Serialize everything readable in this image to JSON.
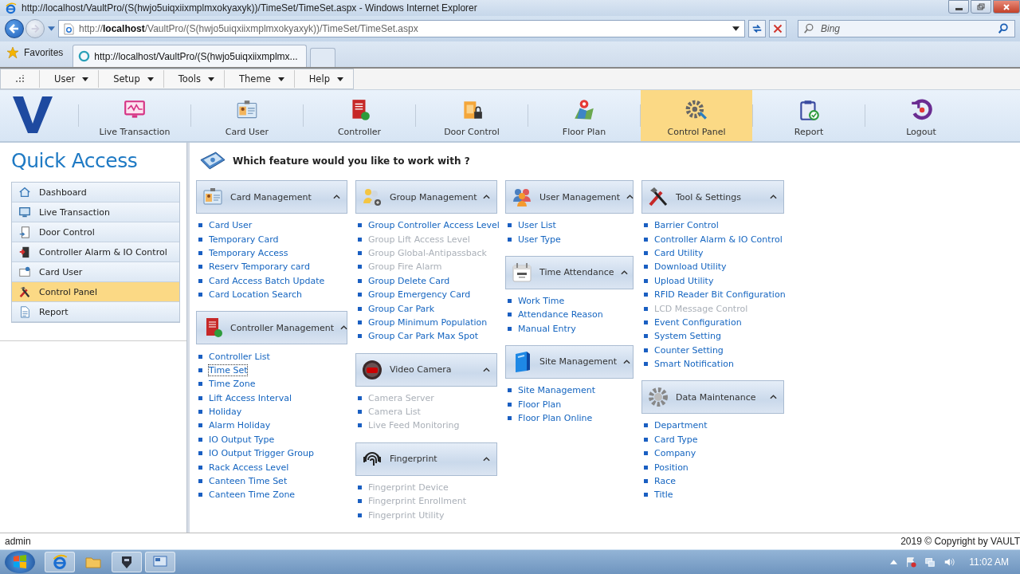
{
  "window": {
    "title": "http://localhost/VaultPro/(S(hwjo5uiqxiixmplmxokyaxyk))/TimeSet/TimeSet.aspx - Windows Internet Explorer"
  },
  "address_bar": {
    "url": "http://**localhost**/VaultPro/(S(hwjo5uiqxiixmplmxokyaxyk))/TimeSet/TimeSet.aspx"
  },
  "search": {
    "placeholder": "Bing"
  },
  "favorites": {
    "label": "Favorites"
  },
  "tabs": [
    {
      "label": "http://localhost/VaultPro/(S(hwjo5uiqxiixmplmx...",
      "selected": true
    }
  ],
  "menu": [
    "User",
    "Setup",
    "Tools",
    "Theme",
    "Help"
  ],
  "nav": [
    {
      "label": "Live Transaction",
      "selected": false
    },
    {
      "label": "Card User",
      "selected": false
    },
    {
      "label": "Controller",
      "selected": false
    },
    {
      "label": "Door Control",
      "selected": false
    },
    {
      "label": "Floor Plan",
      "selected": false
    },
    {
      "label": "Control Panel",
      "selected": true
    },
    {
      "label": "Report",
      "selected": false
    },
    {
      "label": "Logout",
      "selected": false
    }
  ],
  "quick_access": {
    "title": "Quick Access",
    "items": [
      {
        "label": "Dashboard",
        "selected": false
      },
      {
        "label": "Live Transaction",
        "selected": false
      },
      {
        "label": "Door Control",
        "selected": false
      },
      {
        "label": "Controller Alarm & IO Control",
        "selected": false
      },
      {
        "label": "Card User",
        "selected": false
      },
      {
        "label": "Control Panel",
        "selected": true
      },
      {
        "label": "Report",
        "selected": false
      }
    ]
  },
  "panel": {
    "heading": "Which feature would you like to work with ?",
    "columns": [
      [
        {
          "title": "Card Management",
          "expanded": true,
          "items": [
            {
              "label": "Card User",
              "disabled": false,
              "focused": false
            },
            {
              "label": "Temporary Card",
              "disabled": false,
              "focused": false
            },
            {
              "label": "Temporary Access",
              "disabled": false,
              "focused": false
            },
            {
              "label": "Reserv Temporary card",
              "disabled": false,
              "focused": false
            },
            {
              "label": "Card Access Batch Update",
              "disabled": false,
              "focused": false
            },
            {
              "label": "Card Location Search",
              "disabled": false,
              "focused": false
            }
          ]
        },
        {
          "title": "Controller Management",
          "expanded": true,
          "items": [
            {
              "label": "Controller List",
              "disabled": false,
              "focused": false
            },
            {
              "label": "Time Set",
              "disabled": false,
              "focused": true
            },
            {
              "label": "Time Zone",
              "disabled": false,
              "focused": false
            },
            {
              "label": "Lift Access Interval",
              "disabled": false,
              "focused": false
            },
            {
              "label": "Holiday",
              "disabled": false,
              "focused": false
            },
            {
              "label": "Alarm Holiday",
              "disabled": false,
              "focused": false
            },
            {
              "label": "IO Output Type",
              "disabled": false,
              "focused": false
            },
            {
              "label": "IO Output Trigger Group",
              "disabled": false,
              "focused": false
            },
            {
              "label": "Rack Access Level",
              "disabled": false,
              "focused": false
            },
            {
              "label": "Canteen Time Set",
              "disabled": false,
              "focused": false
            },
            {
              "label": "Canteen Time Zone",
              "disabled": false,
              "focused": false
            }
          ]
        }
      ],
      [
        {
          "title": "Group Management",
          "expanded": true,
          "items": [
            {
              "label": "Group Controller Access Level",
              "disabled": false,
              "focused": false
            },
            {
              "label": "Group Lift Access Level",
              "disabled": true,
              "focused": false
            },
            {
              "label": "Group Global-Antipassback",
              "disabled": true,
              "focused": false
            },
            {
              "label": "Group Fire Alarm",
              "disabled": true,
              "focused": false
            },
            {
              "label": "Group Delete Card",
              "disabled": false,
              "focused": false
            },
            {
              "label": "Group Emergency Card",
              "disabled": false,
              "focused": false
            },
            {
              "label": "Group Car Park",
              "disabled": false,
              "focused": false
            },
            {
              "label": "Group Minimum Population",
              "disabled": false,
              "focused": false
            },
            {
              "label": "Group Car Park Max Spot",
              "disabled": false,
              "focused": false
            }
          ]
        },
        {
          "title": "Video Camera",
          "expanded": true,
          "items": [
            {
              "label": "Camera Server",
              "disabled": true,
              "focused": false
            },
            {
              "label": "Camera List",
              "disabled": true,
              "focused": false
            },
            {
              "label": "Live Feed Monitoring",
              "disabled": true,
              "focused": false
            }
          ]
        },
        {
          "title": "Fingerprint",
          "expanded": true,
          "items": [
            {
              "label": "Fingerprint Device",
              "disabled": true,
              "focused": false
            },
            {
              "label": "Fingerprint Enrollment",
              "disabled": true,
              "focused": false
            },
            {
              "label": "Fingerprint Utility",
              "disabled": true,
              "focused": false
            }
          ]
        }
      ],
      [
        {
          "title": "User Management",
          "expanded": true,
          "items": [
            {
              "label": "User List",
              "disabled": false,
              "focused": false
            },
            {
              "label": "User Type",
              "disabled": false,
              "focused": false
            }
          ]
        },
        {
          "title": "Time Attendance",
          "expanded": true,
          "items": [
            {
              "label": "Work Time",
              "disabled": false,
              "focused": false
            },
            {
              "label": "Attendance Reason",
              "disabled": false,
              "focused": false
            },
            {
              "label": "Manual Entry",
              "disabled": false,
              "focused": false
            }
          ]
        },
        {
          "title": "Site Management",
          "expanded": true,
          "items": [
            {
              "label": "Site Management",
              "disabled": false,
              "focused": false
            },
            {
              "label": "Floor Plan",
              "disabled": false,
              "focused": false
            },
            {
              "label": "Floor Plan Online",
              "disabled": false,
              "focused": false
            }
          ]
        }
      ],
      [
        {
          "title": "Tool & Settings",
          "expanded": true,
          "items": [
            {
              "label": "Barrier Control",
              "disabled": false,
              "focused": false
            },
            {
              "label": "Controller Alarm & IO Control",
              "disabled": false,
              "focused": false
            },
            {
              "label": "Card Utility",
              "disabled": false,
              "focused": false
            },
            {
              "label": "Download Utility",
              "disabled": false,
              "focused": false
            },
            {
              "label": "Upload Utility",
              "disabled": false,
              "focused": false
            },
            {
              "label": "RFID Reader Bit Configuration",
              "disabled": false,
              "focused": false
            },
            {
              "label": "LCD Message Control",
              "disabled": true,
              "focused": false
            },
            {
              "label": "Event Configuration",
              "disabled": false,
              "focused": false
            },
            {
              "label": "System Setting",
              "disabled": false,
              "focused": false
            },
            {
              "label": "Counter Setting",
              "disabled": false,
              "focused": false
            },
            {
              "label": "Smart Notification",
              "disabled": false,
              "focused": false
            }
          ]
        },
        {
          "title": "Data Maintenance",
          "expanded": true,
          "items": [
            {
              "label": "Department",
              "disabled": false,
              "focused": false
            },
            {
              "label": "Card Type",
              "disabled": false,
              "focused": false
            },
            {
              "label": "Company",
              "disabled": false,
              "focused": false
            },
            {
              "label": "Position",
              "disabled": false,
              "focused": false
            },
            {
              "label": "Race",
              "disabled": false,
              "focused": false
            },
            {
              "label": "Title",
              "disabled": false,
              "focused": false
            }
          ]
        }
      ]
    ]
  },
  "status_bar": {
    "user": "admin",
    "copyright": "2019 © Copyright by VAULT"
  },
  "taskbar": {
    "clock": "11:02 AM"
  }
}
